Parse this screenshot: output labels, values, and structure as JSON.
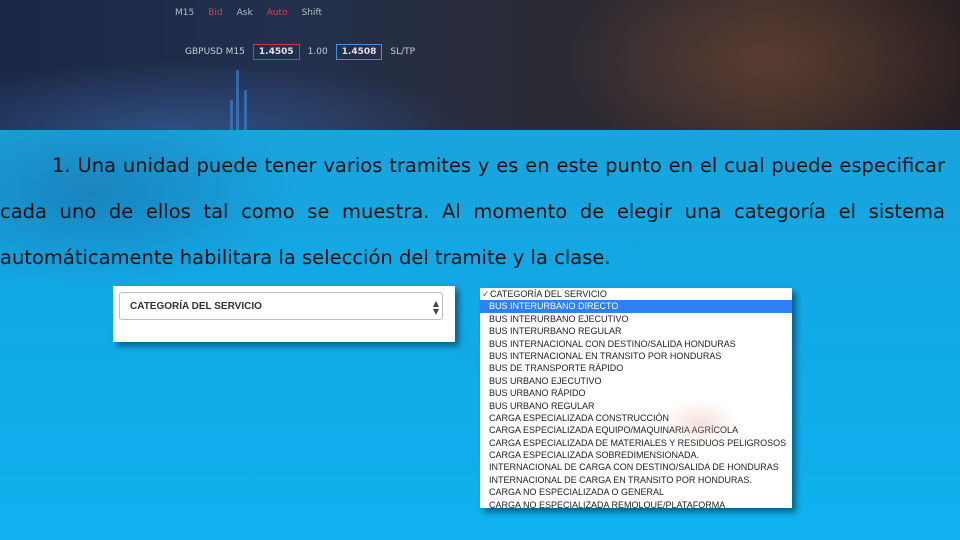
{
  "header": {
    "trade_bar": {
      "timeframe": "M15",
      "bid_label": "Bid",
      "ask_label": "Ask",
      "auto_label": "Auto",
      "shift_label": "Shift"
    },
    "ticker": {
      "symbol": "GBPUSD M15",
      "sell_price": "1.4505",
      "lot": "1.00",
      "buy_price": "1.4508",
      "sltp": "SL/TP"
    }
  },
  "content": {
    "paragraph": "1. Una unidad puede tener varios tramites y es en este punto en el cual puede especificar cada uno de ellos tal como se muestra. Al momento de elegir una categoría el sistema automáticamente habilitara la selección del tramite y la clase."
  },
  "select_screenshot": {
    "value": "CATEGORÍA DEL SERVICIO",
    "up_arrow": "▲",
    "down_arrow": "▼"
  },
  "list_screenshot": {
    "check": "✓",
    "header": "CATEGORÍA DEL SERVICIO",
    "options": [
      "BUS INTERURBANO DIRECTO",
      "BUS INTERURBANO EJECUTIVO",
      "BUS INTERURBANO REGULAR",
      "BUS INTERNACIONAL CON DESTINO/SALIDA HONDURAS",
      "BUS INTERNACIONAL EN TRANSITO POR HONDURAS",
      "BUS DE TRANSPORTE RÁPIDO",
      "BUS URBANO EJECUTIVO",
      "BUS URBANO RÁPIDO",
      "BUS URBANO REGULAR",
      "CARGA ESPECIALIZADA CONSTRUCCIÓN",
      "CARGA ESPECIALIZADA EQUIPO/MAQUINARIA AGRÍCOLA",
      "CARGA ESPECIALIZADA DE MATERIALES Y RESIDUOS PELIGROSOS",
      "CARGA ESPECIALIZADA SOBREDIMENSIONADA.",
      "INTERNACIONAL DE CARGA CON DESTINO/SALIDA DE HONDURAS",
      "INTERNACIONAL DE CARGA EN TRANSITO POR HONDURAS.",
      "CARGA NO ESPECIALIZADA O GENERAL",
      "CARGA NO ESPECIALIZADA REMOLQUE/PLATAFORMA"
    ],
    "selected_index": 0,
    "colors": {
      "selected_bg": "#2f7ff6"
    }
  }
}
